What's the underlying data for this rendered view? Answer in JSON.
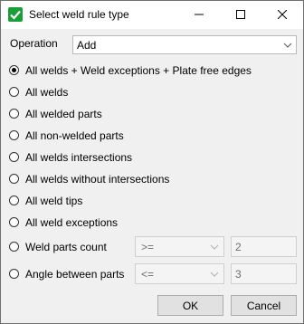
{
  "window": {
    "title": "Select weld rule type"
  },
  "operation": {
    "label": "Operation",
    "value": "Add"
  },
  "options": [
    {
      "label": "All welds + Weld exceptions + Plate free edges",
      "checked": true
    },
    {
      "label": "All welds",
      "checked": false
    },
    {
      "label": "All welded parts",
      "checked": false
    },
    {
      "label": "All non-welded parts",
      "checked": false
    },
    {
      "label": "All welds intersections",
      "checked": false
    },
    {
      "label": "All welds without intersections",
      "checked": false
    },
    {
      "label": "All weld tips",
      "checked": false
    },
    {
      "label": "All weld exceptions",
      "checked": false
    },
    {
      "label": "Weld parts count",
      "checked": false
    },
    {
      "label": "Angle between parts",
      "checked": false
    }
  ],
  "weld_parts_count": {
    "operator": ">=",
    "value": "2"
  },
  "angle_between_parts": {
    "operator": "<=",
    "value": "3"
  },
  "buttons": {
    "ok": "OK",
    "cancel": "Cancel"
  },
  "icons": {
    "app": "green-check-icon",
    "minimize": "minimize-icon",
    "maximize": "maximize-icon",
    "close": "close-icon",
    "dropdown": "chevron-down-icon"
  },
  "colors": {
    "app_icon": "#1a9e3a",
    "title_bar": "#ffffff",
    "dialog_bg": "#f0f0f0"
  }
}
